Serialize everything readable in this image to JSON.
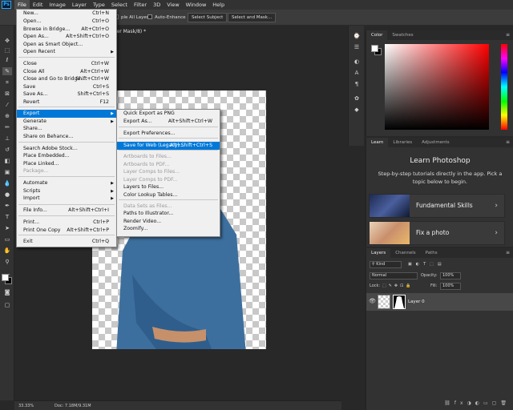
{
  "app": {
    "logo": "Ps"
  },
  "menubar": [
    "File",
    "Edit",
    "Image",
    "Layer",
    "Type",
    "Select",
    "Filter",
    "3D",
    "View",
    "Window",
    "Help"
  ],
  "options": {
    "sample_all_layers": "ple All Layers",
    "auto_enhance": "Auto-Enhance",
    "select_subject": "Select Subject",
    "select_and_mask": "Select and Mask..."
  },
  "document": {
    "tab_title": "yer Mask/8) *"
  },
  "status": {
    "zoom": "33.33%",
    "doc": "Doc: 7.18M/9.31M"
  },
  "file_menu": [
    {
      "label": "New...",
      "shortcut": "Ctrl+N"
    },
    {
      "label": "Open...",
      "shortcut": "Ctrl+O"
    },
    {
      "label": "Browse in Bridge...",
      "shortcut": "Alt+Ctrl+O"
    },
    {
      "label": "Open As...",
      "shortcut": "Alt+Shift+Ctrl+O"
    },
    {
      "label": "Open as Smart Object...",
      "shortcut": ""
    },
    {
      "label": "Open Recent",
      "shortcut": "",
      "submenu": true
    },
    {
      "label": "Close",
      "shortcut": "Ctrl+W"
    },
    {
      "label": "Close All",
      "shortcut": "Alt+Ctrl+W"
    },
    {
      "label": "Close and Go to Bridge...",
      "shortcut": "Shift+Ctrl+W"
    },
    {
      "label": "Save",
      "shortcut": "Ctrl+S"
    },
    {
      "label": "Save As...",
      "shortcut": "Shift+Ctrl+S"
    },
    {
      "label": "Revert",
      "shortcut": "F12"
    },
    {
      "label": "Export",
      "shortcut": "",
      "submenu": true,
      "highlight": true
    },
    {
      "label": "Generate",
      "shortcut": "",
      "submenu": true
    },
    {
      "label": "Share...",
      "shortcut": ""
    },
    {
      "label": "Share on Behance...",
      "shortcut": ""
    },
    {
      "label": "Search Adobe Stock...",
      "shortcut": ""
    },
    {
      "label": "Place Embedded...",
      "shortcut": ""
    },
    {
      "label": "Place Linked...",
      "shortcut": ""
    },
    {
      "label": "Package...",
      "shortcut": "",
      "disabled": true
    },
    {
      "label": "Automate",
      "shortcut": "",
      "submenu": true
    },
    {
      "label": "Scripts",
      "shortcut": "",
      "submenu": true
    },
    {
      "label": "Import",
      "shortcut": "",
      "submenu": true
    },
    {
      "label": "File Info...",
      "shortcut": "Alt+Shift+Ctrl+I"
    },
    {
      "label": "Print...",
      "shortcut": "Ctrl+P"
    },
    {
      "label": "Print One Copy",
      "shortcut": "Alt+Shift+Ctrl+P"
    },
    {
      "label": "Exit",
      "shortcut": "Ctrl+Q"
    }
  ],
  "export_menu": [
    {
      "label": "Quick Export as PNG",
      "shortcut": ""
    },
    {
      "label": "Export As...",
      "shortcut": "Alt+Shift+Ctrl+W"
    },
    {
      "label": "Export Preferences...",
      "shortcut": ""
    },
    {
      "label": "Save for Web (Legacy)...",
      "shortcut": "Alt+Shift+Ctrl+S",
      "highlight": true
    },
    {
      "label": "Artboards to Files...",
      "shortcut": "",
      "disabled": true
    },
    {
      "label": "Artboards to PDF...",
      "shortcut": "",
      "disabled": true
    },
    {
      "label": "Layer Comps to Files...",
      "shortcut": "",
      "disabled": true
    },
    {
      "label": "Layer Comps to PDF...",
      "shortcut": "",
      "disabled": true
    },
    {
      "label": "Layers to Files...",
      "shortcut": ""
    },
    {
      "label": "Color Lookup Tables...",
      "shortcut": ""
    },
    {
      "label": "Data Sets as Files...",
      "shortcut": "",
      "disabled": true
    },
    {
      "label": "Paths to Illustrator...",
      "shortcut": ""
    },
    {
      "label": "Render Video...",
      "shortcut": ""
    },
    {
      "label": "Zoomify...",
      "shortcut": ""
    }
  ],
  "color_panel": {
    "tabs": [
      "Color",
      "Swatches"
    ],
    "foreground": "#ffffff",
    "background": "#000000"
  },
  "learn_panel": {
    "tabs": [
      "Learn",
      "Libraries",
      "Adjustments"
    ],
    "title": "Learn Photoshop",
    "description": "Step-by-step tutorials directly in the app. Pick a topic below to begin.",
    "cards": [
      {
        "label": "Fundamental Skills"
      },
      {
        "label": "Fix a photo"
      }
    ]
  },
  "layers_panel": {
    "tabs": [
      "Layers",
      "Channels",
      "Paths"
    ],
    "kind": "Kind",
    "blend_mode": "Normal",
    "opacity_label": "Opacity:",
    "opacity": "100%",
    "lock_label": "Lock:",
    "fill_label": "Fill:",
    "fill": "100%",
    "layers": [
      {
        "name": "Layer 0"
      }
    ]
  },
  "icons": [
    "move-icon",
    "marquee-icon",
    "lasso-icon",
    "quick-select-icon",
    "crop-icon",
    "eyedropper-icon",
    "healing-icon",
    "brush-icon",
    "stamp-icon",
    "history-brush-icon",
    "eraser-icon",
    "gradient-icon",
    "blur-icon",
    "dodge-icon",
    "pen-icon",
    "type-icon",
    "path-select-icon",
    "shape-icon",
    "hand-icon",
    "zoom-icon"
  ]
}
